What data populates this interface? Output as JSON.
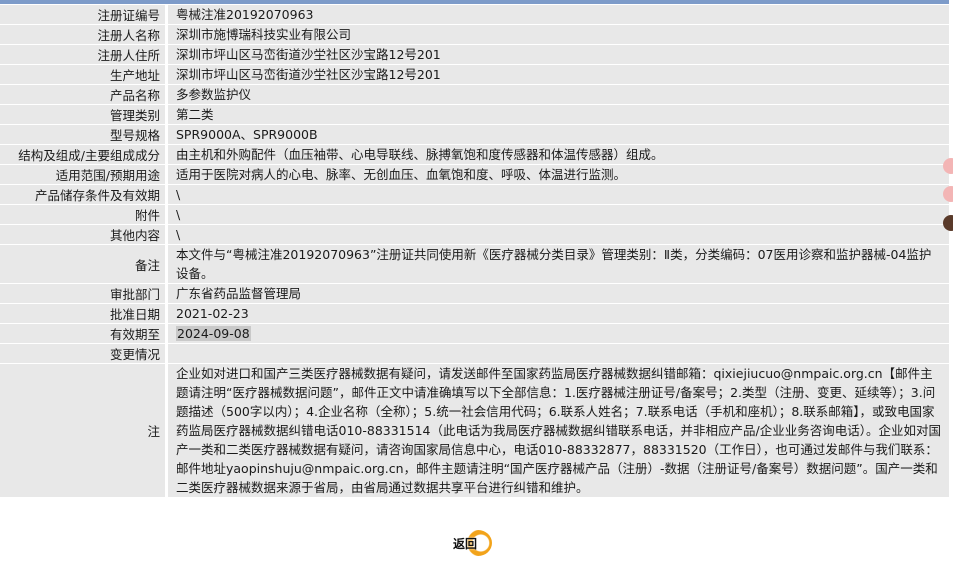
{
  "rows": [
    {
      "label": "注册证编号",
      "value": "粤械注准20192070963"
    },
    {
      "label": "注册人名称",
      "value": "深圳市施博瑞科技实业有限公司"
    },
    {
      "label": "注册人住所",
      "value": "深圳市坪山区马峦街道沙坣社区沙宝路12号201"
    },
    {
      "label": "生产地址",
      "value": "深圳市坪山区马峦街道沙坣社区沙宝路12号201"
    },
    {
      "label": "产品名称",
      "value": "多参数监护仪"
    },
    {
      "label": "管理类别",
      "value": "第二类"
    },
    {
      "label": "型号规格",
      "value": "SPR9000A、SPR9000B"
    },
    {
      "label": "结构及组成/主要组成成分",
      "value": "由主机和外购配件（血压袖带、心电导联线、脉搏氧饱和度传感器和体温传感器）组成。"
    },
    {
      "label": "适用范围/预期用途",
      "value": "适用于医院对病人的心电、脉率、无创血压、血氧饱和度、呼吸、体温进行监测。"
    },
    {
      "label": "产品储存条件及有效期",
      "value": "\\"
    },
    {
      "label": "附件",
      "value": "\\"
    },
    {
      "label": "其他内容",
      "value": "\\"
    },
    {
      "label": "备注",
      "value": "本文件与“粤械注准20192070963”注册证共同使用新《医疗器械分类目录》管理类别：Ⅱ类，分类编码：07医用诊察和监护器械-04监护设备。"
    },
    {
      "label": "审批部门",
      "value": "广东省药品监督管理局"
    },
    {
      "label": "批准日期",
      "value": "2021-02-23"
    },
    {
      "label": "有效期至",
      "value": "2024-09-08"
    },
    {
      "label": "变更情况",
      "value": ""
    }
  ],
  "note": {
    "label": "注",
    "text": "企业如对进口和国产三类医疗器械数据有疑问，请发送邮件至国家药监局医疗器械数据纠错邮箱：qixiejiucuo@nmpaic.org.cn【邮件主题请注明“医疗器械数据问题”，邮件正文中请准确填写以下全部信息：1.医疗器械注册证号/备案号；2.类型（注册、变更、延续等）；3.问题描述（500字以内）；4.企业名称（全称）；5.统一社会信用代码；6.联系人姓名；7.联系电话（手机和座机）；8.联系邮箱】，或致电国家药监局医疗器械数据纠错电话010-88331514（此电话为我局医疗器械数据纠错联系电话，并非相应产品/企业业务咨询电话）。企业如对国产一类和二类医疗器械数据有疑问，请咨询国家局信息中心，电话010-88332877，88331520（工作日），也可通过发邮件与我们联系：邮件地址yaopinshuju@nmpaic.org.cn，邮件主题请注明“国产医疗器械产品（注册）-数据（注册证号/备案号）数据问题”。国产一类和二类医疗器械数据来源于省局，由省局通过数据共享平台进行纠错和维护。"
  },
  "back_button": {
    "label": "返回"
  },
  "colors": {
    "row_bg": "#e8e8e8",
    "top_bar": "#7d9bc9",
    "highlight": "#c9c9c9",
    "back_ring": "#f2a31a"
  }
}
